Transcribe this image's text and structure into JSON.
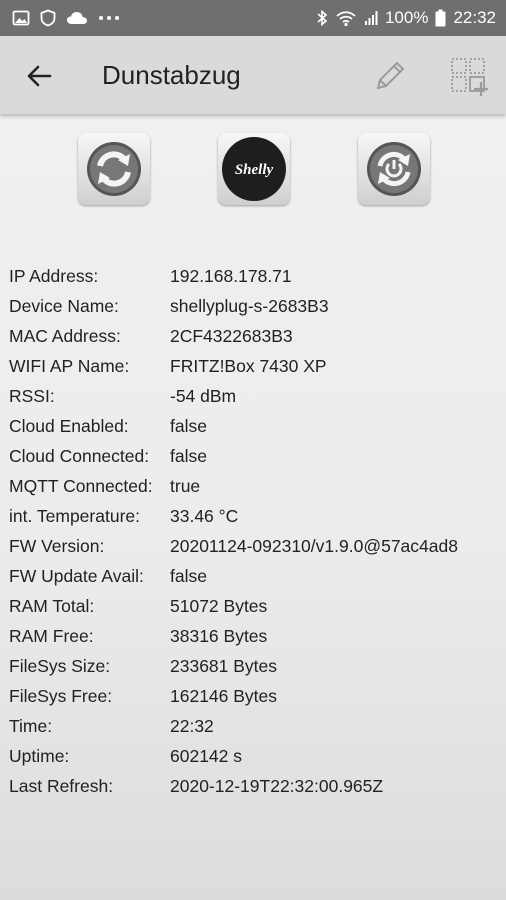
{
  "status_bar": {
    "battery": "100%",
    "time": "22:32"
  },
  "app_bar": {
    "title": "Dunstabzug"
  },
  "actions": {
    "logo_text": "Shelly"
  },
  "info": [
    {
      "label": "IP  Address:",
      "value": "192.168.178.71"
    },
    {
      "label": "Device Name:",
      "value": "shellyplug-s-2683B3"
    },
    {
      "label": "MAC Address:",
      "value": "2CF4322683B3"
    },
    {
      "label": "WIFI AP Name:",
      "value": "FRITZ!Box 7430 XP"
    },
    {
      "label": "RSSI:",
      "value": "-54 dBm"
    },
    {
      "label": "Cloud Enabled:",
      "value": "false"
    },
    {
      "label": "Cloud Connected:",
      "value": "false"
    },
    {
      "label": "MQTT Connected:",
      "value": "true"
    },
    {
      "label": "int. Temperature:",
      "value": "33.46 °C"
    },
    {
      "label": "FW Version:",
      "value": "20201124-092310/v1.9.0@57ac4ad8"
    },
    {
      "label": "FW Update Avail:",
      "value": "false"
    },
    {
      "label": "RAM Total:",
      "value": "51072 Bytes"
    },
    {
      "label": "RAM Free:",
      "value": "38316 Bytes"
    },
    {
      "label": "FileSys Size:",
      "value": "233681 Bytes"
    },
    {
      "label": "FileSys Free:",
      "value": "162146 Bytes"
    },
    {
      "label": "Time:",
      "value": "22:32"
    },
    {
      "label": "Uptime:",
      "value": "602142 s"
    },
    {
      "label": "Last Refresh:",
      "value": "2020-12-19T22:32:00.965Z"
    }
  ]
}
